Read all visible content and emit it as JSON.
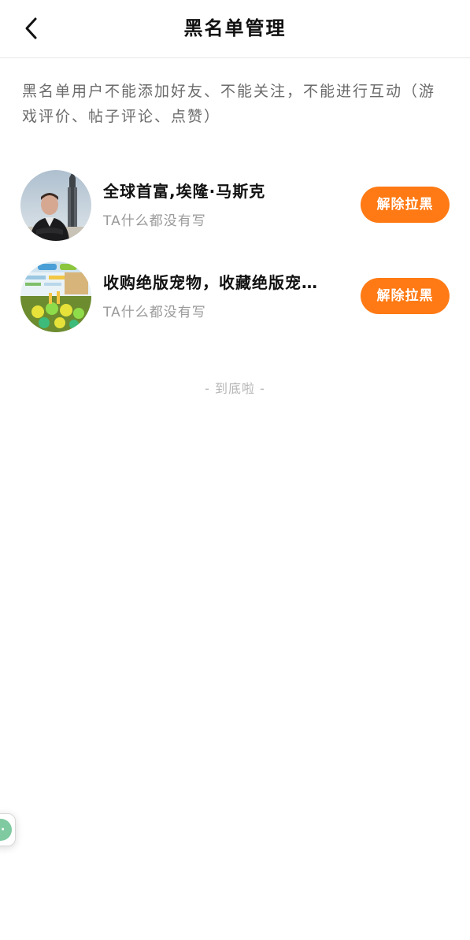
{
  "header": {
    "title": "黑名单管理",
    "back_icon": "chevron-left-icon"
  },
  "notice": "黑名单用户不能添加好友、不能关注，不能进行互动（游戏评价、帖子评论、点赞）",
  "blacklist": [
    {
      "name": "全球首富,埃隆·马斯克",
      "bio": "TA什么都没有写",
      "button": "解除拉黑",
      "avatar": "person-photo-avatar"
    },
    {
      "name": "收购绝版宠物，收藏绝版宠…",
      "bio": "TA什么都没有写",
      "button": "解除拉黑",
      "avatar": "game-screenshot-avatar"
    }
  ],
  "end_text": "- 到底啦 -",
  "floating_button": {
    "icon": "more-dots-icon",
    "label": "··"
  },
  "colors": {
    "accent": "#ff7a14",
    "text_secondary": "#9a9a9a",
    "divider": "#e6e6e6",
    "float_green": "#7fcaa0"
  }
}
